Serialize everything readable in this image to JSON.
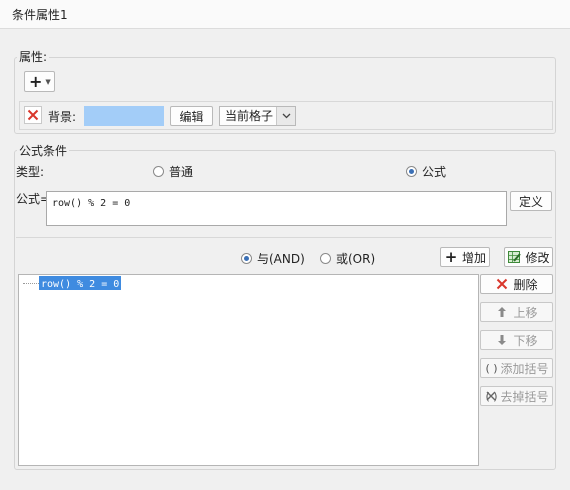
{
  "window": {
    "title": "条件属性1"
  },
  "attributes": {
    "group_label": "属性:",
    "add_button_icon": "plus-dropdown-icon",
    "background": {
      "remove_icon": "red-x-icon",
      "label": "背景:",
      "color": "#a3cdf8",
      "edit_label": "编辑",
      "scope_value": "当前格子"
    }
  },
  "formula_condition": {
    "group_label": "公式条件",
    "type_label": "类型:",
    "type_options": [
      {
        "label": "普通",
        "checked": false
      },
      {
        "label": "公式",
        "checked": true
      }
    ],
    "formula_label": "公式=",
    "formula_value": "row() % 2 = 0",
    "define_label": "定义",
    "logic_options": [
      {
        "label": "与(AND)",
        "checked": true
      },
      {
        "label": "或(OR)",
        "checked": false
      }
    ],
    "add_label": "增加",
    "modify_label": "修改",
    "conditions": [
      "row() % 2 = 0"
    ],
    "side_buttons": [
      {
        "label": "删除",
        "icon": "red-x-icon",
        "enabled": true
      },
      {
        "label": "上移",
        "icon": "arrow-up-icon",
        "enabled": false
      },
      {
        "label": "下移",
        "icon": "arrow-down-icon",
        "enabled": false
      },
      {
        "label": "添加括号",
        "icon": "add-parentheses-icon",
        "enabled": false
      },
      {
        "label": "去掉括号",
        "icon": "remove-parentheses-icon",
        "enabled": false
      }
    ]
  },
  "colors": {
    "selection": "#3f8be0",
    "accent_red": "#d9362b",
    "radio_dot": "#3a6fb5"
  }
}
